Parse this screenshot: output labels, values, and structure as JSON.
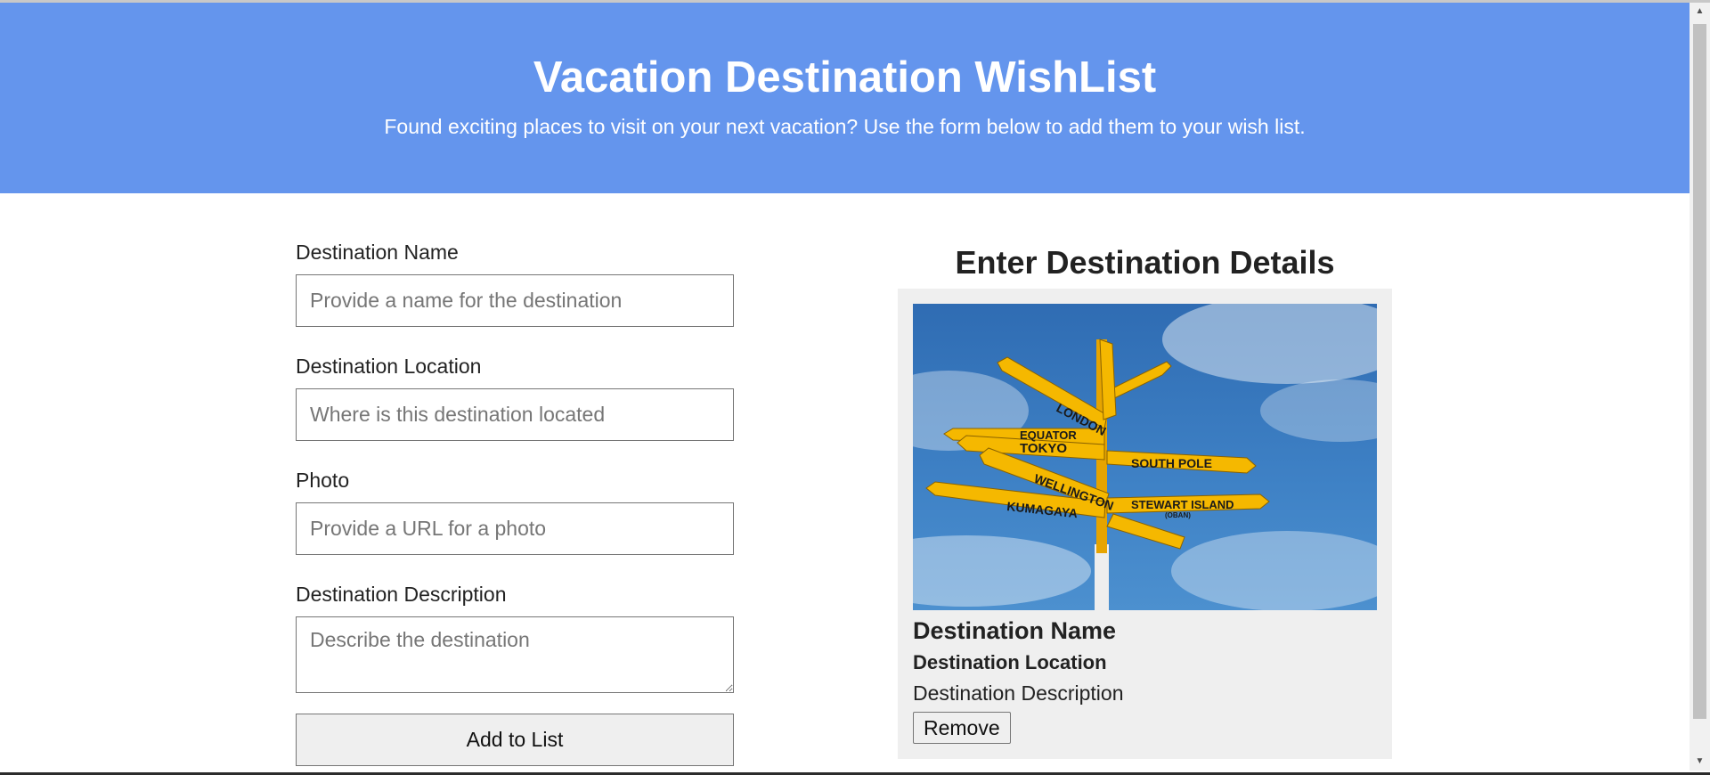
{
  "header": {
    "title": "Vacation Destination WishList",
    "subtitle": "Found exciting places to visit on your next vacation? Use the form below to add them to your wish list."
  },
  "form": {
    "name_label": "Destination Name",
    "name_placeholder": "Provide a name for the destination",
    "location_label": "Destination Location",
    "location_placeholder": "Where is this destination located",
    "photo_label": "Photo",
    "photo_placeholder": "Provide a URL for a photo",
    "description_label": "Destination Description",
    "description_placeholder": "Describe the destination",
    "submit_label": "Add to List"
  },
  "details": {
    "heading": "Enter Destination Details",
    "card": {
      "name": "Destination Name",
      "location": "Destination Location",
      "description": "Destination Description",
      "remove_label": "Remove",
      "photo_signs": [
        "LONDON",
        "EQUATOR",
        "TOKYO",
        "SOUTH POLE",
        "WELLINGTON",
        "KUMAGAYA",
        "STEWART ISLAND",
        "(OBAN)"
      ]
    }
  },
  "colors": {
    "banner": "#6495ed",
    "card": "#efefef",
    "sign": "#f5b800"
  }
}
